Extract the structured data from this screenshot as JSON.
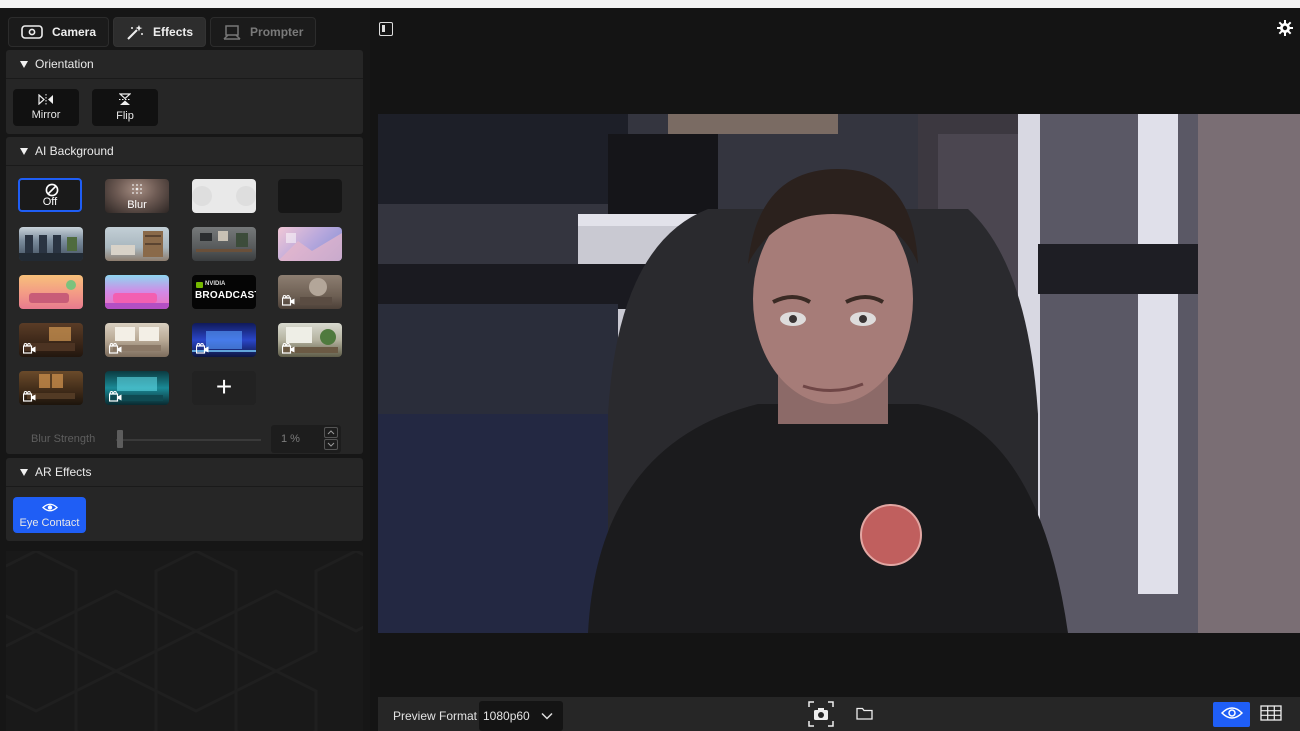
{
  "tabs": [
    {
      "label": "Camera",
      "icon": "camera-icon",
      "state": "normal"
    },
    {
      "label": "Effects",
      "icon": "magic-wand-icon",
      "state": "active"
    },
    {
      "label": "Prompter",
      "icon": "prompter-icon",
      "state": "disabled"
    }
  ],
  "orientation": {
    "title": "Orientation",
    "mirror_label": "Mirror",
    "flip_label": "Flip"
  },
  "ai_background": {
    "title": "AI Background",
    "off_label": "Off",
    "blur_label": "Blur",
    "broadcast_small": "NVIDIA",
    "broadcast_big": "BROADCAST",
    "add_label": "+",
    "blur_strength_label": "Blur Strength",
    "blur_strength_value": "1 %",
    "blur_strength_percent": 1
  },
  "ar_effects": {
    "title": "AR Effects",
    "eye_contact_label": "Eye Contact"
  },
  "preview": {
    "format_label": "Preview Format",
    "format_value": "1080p60"
  },
  "colors": {
    "accent": "#1f5ef5",
    "panel": "#262626",
    "background": "#141414"
  }
}
